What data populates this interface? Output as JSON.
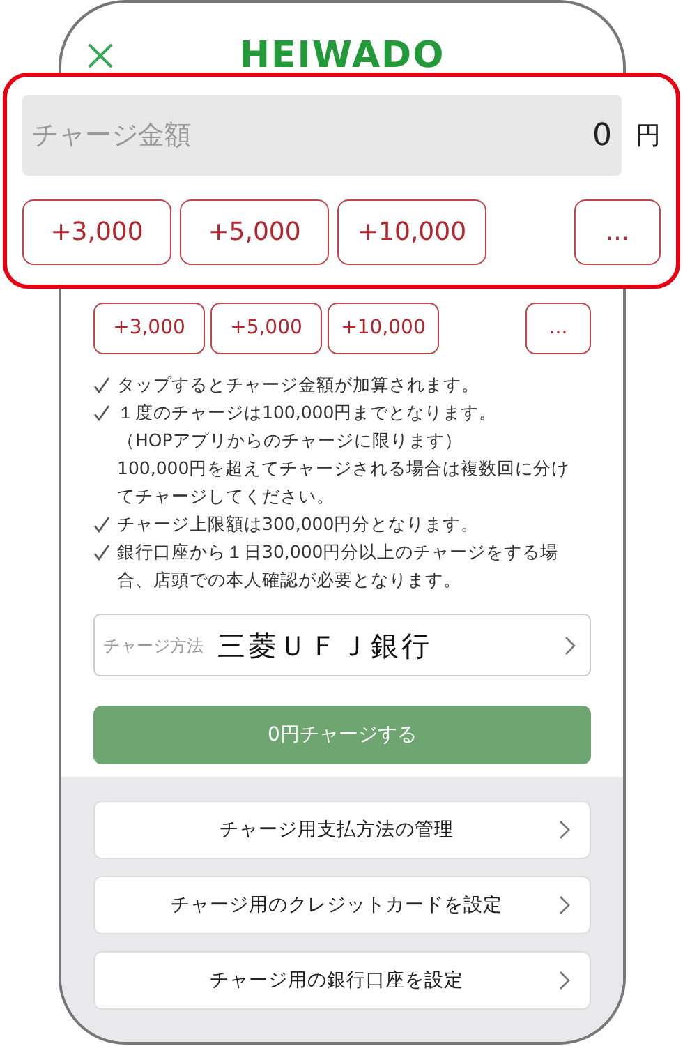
{
  "header": {
    "logo": "HEIWADO"
  },
  "callout": {
    "amount_field": {
      "placeholder": "チャージ金額",
      "value": "0",
      "unit": "円"
    },
    "quick_buttons": [
      "+3,000",
      "+5,000",
      "+10,000",
      "..."
    ]
  },
  "quick_buttons": [
    "+3,000",
    "+5,000",
    "+10,000",
    "..."
  ],
  "notes": [
    {
      "kind": "check",
      "text": "タップするとチャージ金額が加算されます。"
    },
    {
      "kind": "check",
      "text": "１度のチャージは100,000円までとなります。"
    },
    {
      "kind": "sub",
      "text": "（HOPアプリからのチャージに限ります）"
    },
    {
      "kind": "indent",
      "text": "100,000円を超えてチャージされる場合は複数回に分けてチャージしてください。"
    },
    {
      "kind": "check",
      "text": "チャージ上限額は300,000円分となります。"
    },
    {
      "kind": "check",
      "text": "銀行口座から１日30,000円分以上のチャージをする場合、店頭での本人確認が必要となります。"
    }
  ],
  "charge_method": {
    "label": "チャージ方法",
    "value": "三菱ＵＦＪ銀行"
  },
  "charge_button": "0円チャージする",
  "menu": [
    "チャージ用支払方法の管理",
    "チャージ用のクレジットカードを設定",
    "チャージ用の銀行口座を設定"
  ]
}
